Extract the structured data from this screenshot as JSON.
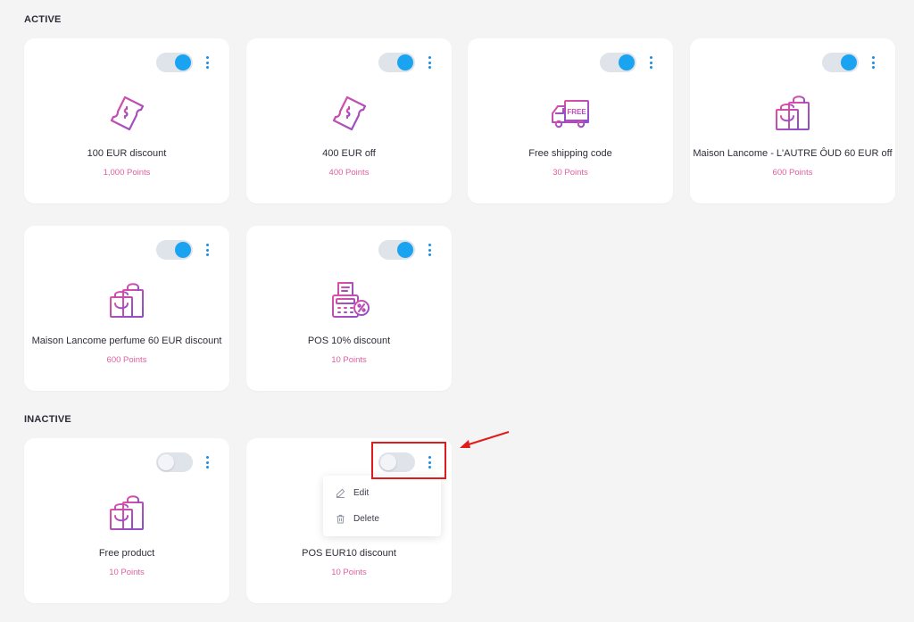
{
  "sections": {
    "active": "ACTIVE",
    "inactive": "INACTIVE"
  },
  "cards": [
    {
      "name": "100 EUR discount",
      "points": "1,000 Points",
      "icon": "ticket-icon",
      "enabled": true
    },
    {
      "name": "400 EUR off",
      "points": "400 Points",
      "icon": "ticket-icon",
      "enabled": true
    },
    {
      "name": "Free shipping code",
      "points": "30 Points",
      "icon": "truck-icon",
      "enabled": true
    },
    {
      "name": "Maison Lancome - L'AUTRE ÔUD 60 EUR off",
      "points": "600 Points",
      "icon": "shopping-bag-icon",
      "enabled": true
    },
    {
      "name": "Maison Lancome perfume 60 EUR discount",
      "points": "600 Points",
      "icon": "shopping-bag-icon",
      "enabled": true
    },
    {
      "name": "POS 10% discount",
      "points": "10 Points",
      "icon": "pos-terminal-icon",
      "enabled": true
    },
    {
      "name": "Free product",
      "points": "10 Points",
      "icon": "shopping-bag-icon",
      "enabled": false
    },
    {
      "name": "POS EUR10 discount",
      "points": "10 Points",
      "icon": "pos-terminal-icon",
      "enabled": false
    }
  ],
  "menu": {
    "edit": "Edit",
    "delete": "Delete"
  },
  "icon_text": {
    "free": "FREE"
  },
  "colors": {
    "accent": "#1aa3f0",
    "points": "#e0609f",
    "icon_gradient_start": "#e24fa3",
    "icon_gradient_end": "#8b4fc9",
    "highlight": "#e01b1b"
  }
}
